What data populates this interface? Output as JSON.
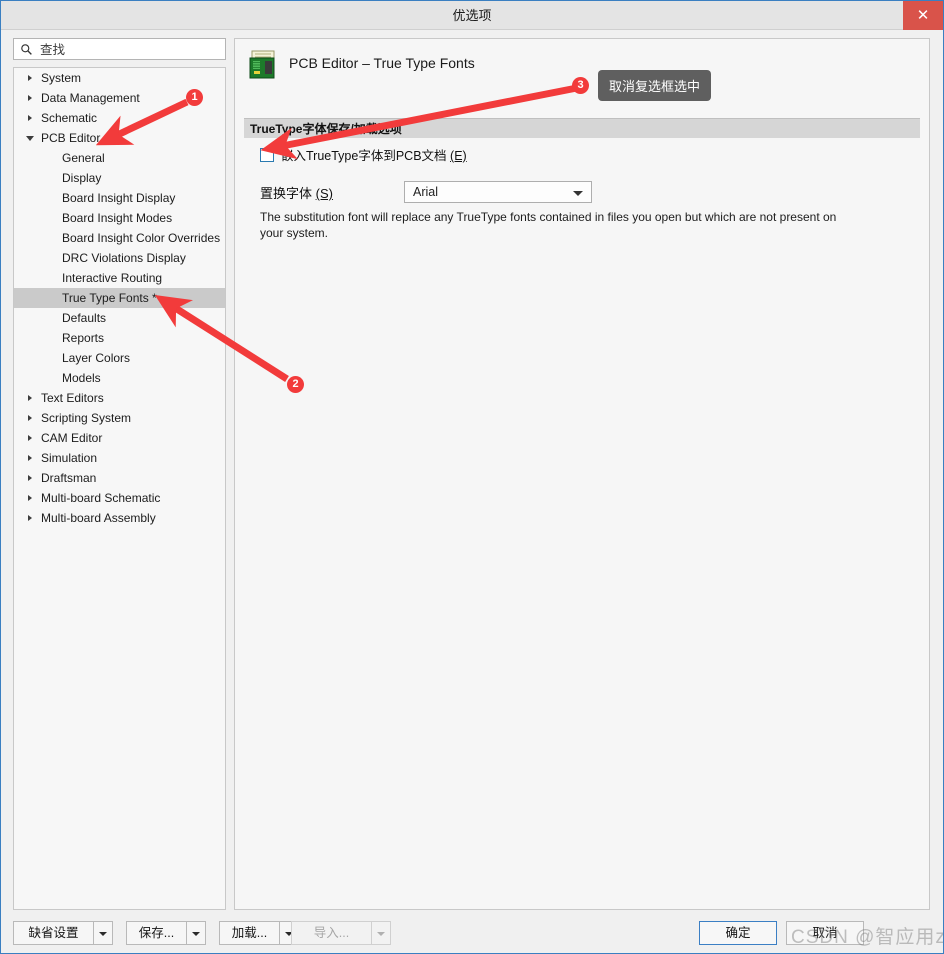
{
  "window": {
    "title": "优选项",
    "close_label": "✕"
  },
  "search": {
    "placeholder": "查找",
    "value": "",
    "icon": "search-icon"
  },
  "sidebar": {
    "items": [
      {
        "label": "System",
        "level": 0,
        "expandable": true,
        "expanded": false,
        "selected": false
      },
      {
        "label": "Data Management",
        "level": 0,
        "expandable": true,
        "expanded": false,
        "selected": false
      },
      {
        "label": "Schematic",
        "level": 0,
        "expandable": true,
        "expanded": false,
        "selected": false
      },
      {
        "label": "PCB Editor",
        "level": 0,
        "expandable": true,
        "expanded": true,
        "selected": false
      },
      {
        "label": "General",
        "level": 1,
        "expandable": false,
        "expanded": false,
        "selected": false
      },
      {
        "label": "Display",
        "level": 1,
        "expandable": false,
        "expanded": false,
        "selected": false
      },
      {
        "label": "Board Insight Display",
        "level": 1,
        "expandable": false,
        "expanded": false,
        "selected": false
      },
      {
        "label": "Board Insight Modes",
        "level": 1,
        "expandable": false,
        "expanded": false,
        "selected": false
      },
      {
        "label": "Board Insight Color Overrides",
        "level": 1,
        "expandable": false,
        "expanded": false,
        "selected": false
      },
      {
        "label": "DRC Violations Display",
        "level": 1,
        "expandable": false,
        "expanded": false,
        "selected": false
      },
      {
        "label": "Interactive Routing",
        "level": 1,
        "expandable": false,
        "expanded": false,
        "selected": false
      },
      {
        "label": "True Type Fonts *",
        "level": 1,
        "expandable": false,
        "expanded": false,
        "selected": true
      },
      {
        "label": "Defaults",
        "level": 1,
        "expandable": false,
        "expanded": false,
        "selected": false
      },
      {
        "label": "Reports",
        "level": 1,
        "expandable": false,
        "expanded": false,
        "selected": false
      },
      {
        "label": "Layer Colors",
        "level": 1,
        "expandable": false,
        "expanded": false,
        "selected": false
      },
      {
        "label": "Models",
        "level": 1,
        "expandable": false,
        "expanded": false,
        "selected": false
      },
      {
        "label": "Text Editors",
        "level": 0,
        "expandable": true,
        "expanded": false,
        "selected": false
      },
      {
        "label": "Scripting System",
        "level": 0,
        "expandable": true,
        "expanded": false,
        "selected": false
      },
      {
        "label": "CAM Editor",
        "level": 0,
        "expandable": true,
        "expanded": false,
        "selected": false
      },
      {
        "label": "Simulation",
        "level": 0,
        "expandable": true,
        "expanded": false,
        "selected": false
      },
      {
        "label": "Draftsman",
        "level": 0,
        "expandable": true,
        "expanded": false,
        "selected": false
      },
      {
        "label": "Multi-board Schematic",
        "level": 0,
        "expandable": true,
        "expanded": false,
        "selected": false
      },
      {
        "label": "Multi-board Assembly",
        "level": 0,
        "expandable": true,
        "expanded": false,
        "selected": false
      }
    ]
  },
  "main": {
    "page_title": "PCB Editor – True Type Fonts",
    "page_icon": "pcb-board-icon",
    "section_header": "TrueType字体保存/加载选项",
    "checkbox": {
      "label": "嵌入TrueType字体到PCB文档",
      "mnemonic": "(E)",
      "checked": false
    },
    "combo": {
      "label": "置换字体",
      "mnemonic": "(S)",
      "value": "Arial"
    },
    "help_text": "The substitution font will replace any TrueType fonts contained in files you open but which are not present on your system."
  },
  "footer": {
    "defaults_label": "缺省设置",
    "save_label": "保存...",
    "load_label": "加载...",
    "import_label": "导入...",
    "ok_label": "确定",
    "cancel_label": "取消"
  },
  "annotations": {
    "badge1": "1",
    "badge2": "2",
    "badge3": "3",
    "callout3": "取消复选框选中"
  },
  "watermark": {
    "text": "CSDN @智应用zb"
  },
  "colors": {
    "accent_red": "#f23b3b",
    "close_red": "#d9534a",
    "window_border_blue": "#3a7fc1",
    "selection_gray": "#cacaca",
    "callout_gray": "#5f5f5f"
  }
}
